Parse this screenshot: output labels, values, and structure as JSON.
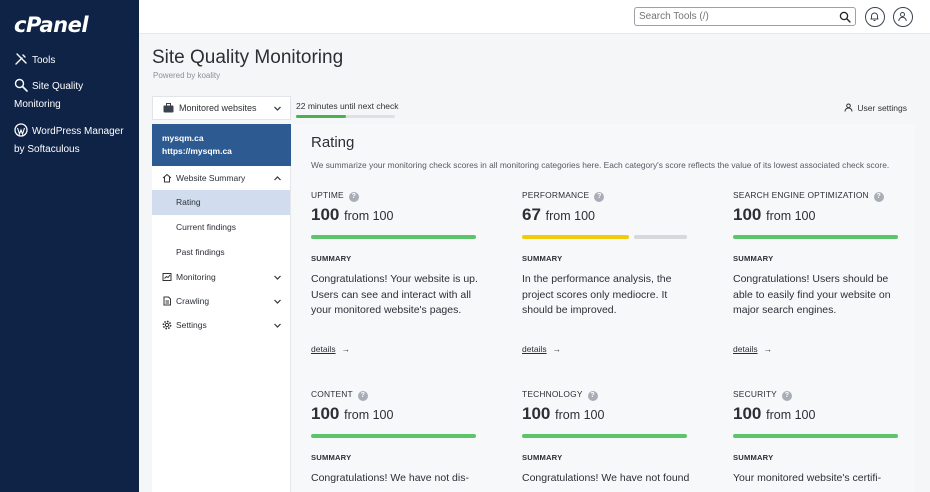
{
  "cpanel": {
    "logo": "cPanel",
    "nav": [
      {
        "label": "Tools",
        "icon": "tools-icon"
      },
      {
        "label": "Site Quality",
        "label2": "Monitoring",
        "icon": "magnifier-icon"
      },
      {
        "label": "WordPress Manager",
        "label2": "by Softaculous",
        "icon": "wordpress-icon"
      }
    ]
  },
  "topbar": {
    "search_placeholder": "Search Tools (/)"
  },
  "header": {
    "title": "Site Quality Monitoring",
    "powered": "Powered by koality"
  },
  "app": {
    "monitored_label": "Monitored websites",
    "next_check": "22 minutes until next check",
    "next_check_progress": 0.5,
    "user_settings": "User settings",
    "site": {
      "name": "mysqm.ca",
      "url": "https://mysqm.ca"
    },
    "menu": {
      "summary": "Website Summary",
      "sub": [
        "Rating",
        "Current findings",
        "Past findings"
      ],
      "monitoring": "Monitoring",
      "crawling": "Crawling",
      "settings": "Settings"
    }
  },
  "rating": {
    "title": "Rating",
    "description": "We summarize your monitoring check scores in all monitoring categories here. Each category's score reflects the value of its lowest associated check score.",
    "summary_label": "SUMMARY",
    "details_label": "details",
    "cards": [
      {
        "category": "UPTIME",
        "score": "100",
        "from": "from 100",
        "summary": "Congratulations! Your website is up. Users can see and interact with all your monitored website's pages.",
        "bar": [
          {
            "fraction": 1.0,
            "color": "#5cc46b"
          }
        ]
      },
      {
        "category": "PERFORMANCE",
        "score": "67",
        "from": "from 100",
        "summary": "In the performance analysis, the project scores only mediocre. It should be improved.",
        "bar": [
          {
            "fraction": 0.67,
            "color": "#f2cc0c"
          },
          {
            "fraction": 0.33,
            "color": "#d6d8dc"
          }
        ]
      },
      {
        "category": "SEARCH ENGINE OPTIMIZATION",
        "score": "100",
        "from": "from 100",
        "summary": "Congratulations! Users should be able to easily find your website on major search engines.",
        "bar": [
          {
            "fraction": 1.0,
            "color": "#5cc46b"
          }
        ]
      },
      {
        "category": "CONTENT",
        "score": "100",
        "from": "from 100",
        "summary": "Congratulations! We have not dis-",
        "bar": [
          {
            "fraction": 1.0,
            "color": "#5cc46b"
          }
        ]
      },
      {
        "category": "TECHNOLOGY",
        "score": "100",
        "from": "from 100",
        "summary": "Congratulations! We have not found",
        "bar": [
          {
            "fraction": 1.0,
            "color": "#5cc46b"
          }
        ]
      },
      {
        "category": "SECURITY",
        "score": "100",
        "from": "from 100",
        "summary": "Your monitored website's certifi-",
        "bar": [
          {
            "fraction": 1.0,
            "color": "#5cc46b"
          }
        ]
      }
    ]
  }
}
